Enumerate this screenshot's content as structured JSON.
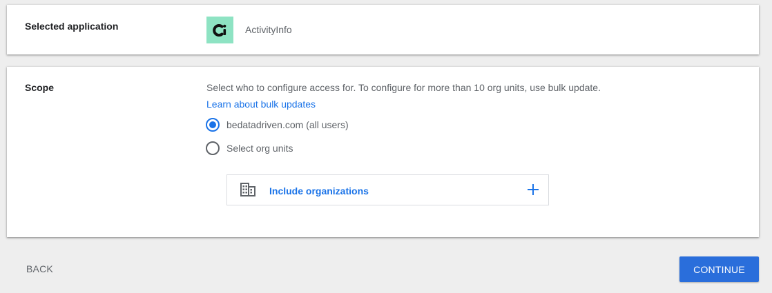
{
  "application_card": {
    "label": "Selected application",
    "app_name": "ActivityInfo",
    "app_logo_icon": "activityinfo-logo-icon",
    "logo_color": "#8ee3c3"
  },
  "scope_card": {
    "label": "Scope",
    "description": "Select who to configure access for. To configure for more than 10 org units, use bulk update.",
    "link": "Learn about bulk updates",
    "options": [
      {
        "label": "bedatadriven.com (all users)",
        "selected": true
      },
      {
        "label": "Select org units",
        "selected": false
      }
    ],
    "include": {
      "icon": "building-icon",
      "label": "Include organizations",
      "action_icon": "plus-icon"
    }
  },
  "footer": {
    "back_label": "BACK",
    "continue_label": "CONTINUE"
  },
  "colors": {
    "accent": "#1a73e8",
    "primary_button": "#2a6edb",
    "background": "#eeeeee"
  }
}
